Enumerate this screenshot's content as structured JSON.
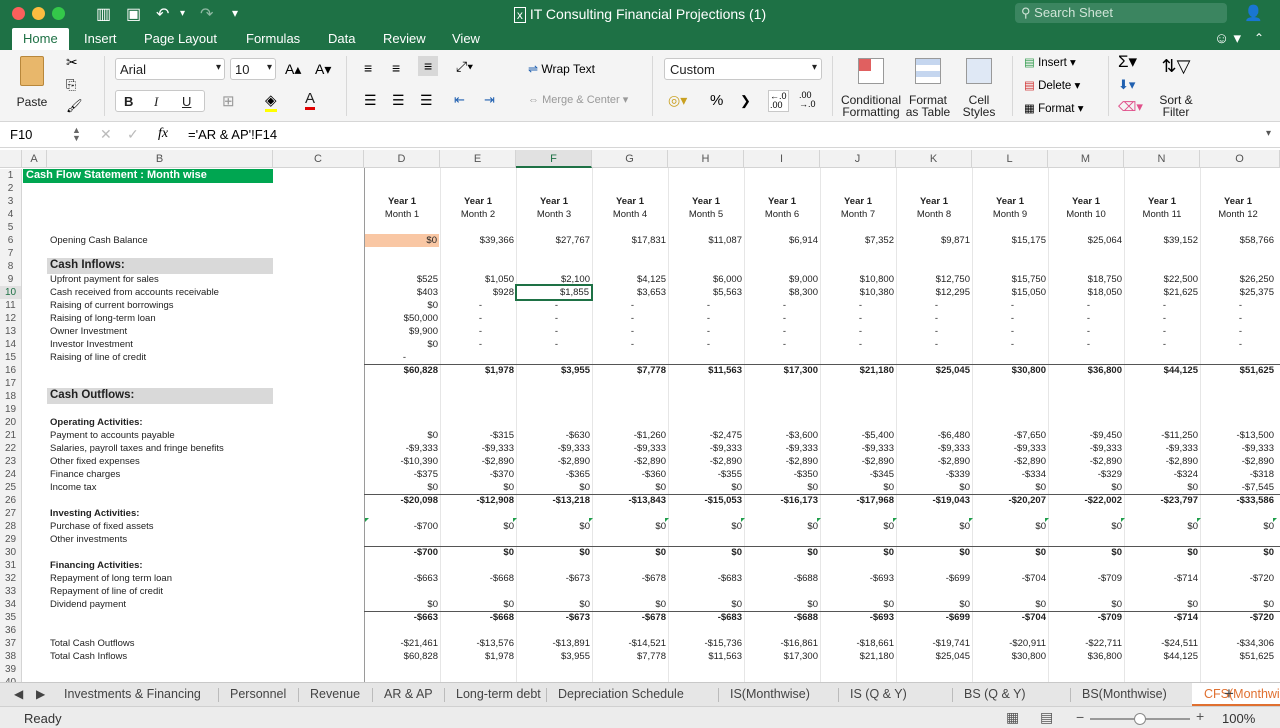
{
  "app": {
    "title": "IT Consulting Financial Projections (1)",
    "search_placeholder": "Search Sheet",
    "colors": {
      "accent": "#1e7145",
      "active_sheet": "#e07030",
      "title_fill": "#00a651",
      "opening_highlight": "#f9c7a4"
    }
  },
  "ribbon_tabs": [
    "Home",
    "Insert",
    "Page Layout",
    "Formulas",
    "Data",
    "Review",
    "View"
  ],
  "ribbon": {
    "paste": "Paste",
    "font_name": "Arial",
    "font_size": "10",
    "bold": "B",
    "italic": "I",
    "underline": "U",
    "wrap_text": "Wrap Text",
    "merge_center": "Merge & Center",
    "number_format": "Custom",
    "percent": "%",
    "comma": "❯",
    "cond_format": [
      "Conditional",
      "Formatting"
    ],
    "format_table": [
      "Format",
      "as Table"
    ],
    "cell_styles": [
      "Cell",
      "Styles"
    ],
    "insert": "Insert",
    "delete": "Delete",
    "format": "Format",
    "sort_filter": [
      "Sort &",
      "Filter"
    ]
  },
  "formula_bar": {
    "name_box": "F10",
    "formula": "='AR & AP'!F14"
  },
  "columns": [
    "A",
    "B",
    "C",
    "D",
    "E",
    "F",
    "G",
    "H",
    "I",
    "J",
    "K",
    "L",
    "M",
    "N",
    "O"
  ],
  "selected_col": "F",
  "selected_row": "10",
  "sheet": {
    "title": "Cash Flow Statement : Month wise",
    "year_labels": [
      "Year 1",
      "Year 1",
      "Year 1",
      "Year 1",
      "Year 1",
      "Year 1",
      "Year 1",
      "Year 1",
      "Year 1",
      "Year 1",
      "Year 1",
      "Year 1"
    ],
    "month_labels": [
      "Month 1",
      "Month 2",
      "Month 3",
      "Month 4",
      "Month 5",
      "Month 6",
      "Month 7",
      "Month 8",
      "Month 9",
      "Month 10",
      "Month 11",
      "Month 12"
    ],
    "rows": [
      {
        "r": 6,
        "label": "Opening Cash Balance",
        "values": [
          "$0",
          "$39,366",
          "$27,767",
          "$17,831",
          "$11,087",
          "$6,914",
          "$7,352",
          "$9,871",
          "$15,175",
          "$25,064",
          "$39,152",
          "$58,766"
        ]
      },
      {
        "r": 8,
        "label": "Cash Inflows:",
        "section": true
      },
      {
        "r": 9,
        "label": "Upfront payment for sales",
        "values": [
          "$525",
          "$1,050",
          "$2,100",
          "$4,125",
          "$6,000",
          "$9,000",
          "$10,800",
          "$12,750",
          "$15,750",
          "$18,750",
          "$22,500",
          "$26,250"
        ]
      },
      {
        "r": 10,
        "label": "Cash received from accounts receivable",
        "values": [
          "$403",
          "$928",
          "$1,855",
          "$3,653",
          "$5,563",
          "$8,300",
          "$10,380",
          "$12,295",
          "$15,050",
          "$18,050",
          "$21,625",
          "$25,375"
        ]
      },
      {
        "r": 11,
        "label": "Raising of current borrowings",
        "values": [
          "$0",
          "-",
          "-",
          "-",
          "-",
          "-",
          "-",
          "-",
          "-",
          "-",
          "-",
          "-"
        ]
      },
      {
        "r": 12,
        "label": "Raising of long-term loan",
        "values": [
          "$50,000",
          "-",
          "-",
          "-",
          "-",
          "-",
          "-",
          "-",
          "-",
          "-",
          "-",
          "-"
        ]
      },
      {
        "r": 13,
        "label": "Owner Investment",
        "values": [
          "$9,900",
          "-",
          "-",
          "-",
          "-",
          "-",
          "-",
          "-",
          "-",
          "-",
          "-",
          "-"
        ]
      },
      {
        "r": 14,
        "label": "Investor Investment",
        "values": [
          "$0",
          "-",
          "-",
          "-",
          "-",
          "-",
          "-",
          "-",
          "-",
          "-",
          "-",
          "-"
        ]
      },
      {
        "r": 15,
        "label": "Raising of line of credit",
        "values": [
          "-",
          "",
          "",
          "",
          "",
          "",
          "",
          "",
          "",
          "",
          "",
          ""
        ]
      },
      {
        "r": 16,
        "label": "",
        "bold": true,
        "values": [
          "$60,828",
          "$1,978",
          "$3,955",
          "$7,778",
          "$11,563",
          "$17,300",
          "$21,180",
          "$25,045",
          "$30,800",
          "$36,800",
          "$44,125",
          "$51,625"
        ]
      },
      {
        "r": 18,
        "label": "Cash Outflows:",
        "section": true
      },
      {
        "r": 20,
        "label": "Operating Activities:",
        "bold": true
      },
      {
        "r": 21,
        "label": "Payment to accounts payable",
        "values": [
          "$0",
          "-$315",
          "-$630",
          "-$1,260",
          "-$2,475",
          "-$3,600",
          "-$5,400",
          "-$6,480",
          "-$7,650",
          "-$9,450",
          "-$11,250",
          "-$13,500"
        ]
      },
      {
        "r": 22,
        "label": "Salaries, payroll taxes and fringe benefits",
        "values": [
          "-$9,333",
          "-$9,333",
          "-$9,333",
          "-$9,333",
          "-$9,333",
          "-$9,333",
          "-$9,333",
          "-$9,333",
          "-$9,333",
          "-$9,333",
          "-$9,333",
          "-$9,333"
        ]
      },
      {
        "r": 23,
        "label": "Other fixed expenses",
        "values": [
          "-$10,390",
          "-$2,890",
          "-$2,890",
          "-$2,890",
          "-$2,890",
          "-$2,890",
          "-$2,890",
          "-$2,890",
          "-$2,890",
          "-$2,890",
          "-$2,890",
          "-$2,890"
        ]
      },
      {
        "r": 24,
        "label": "Finance charges",
        "values": [
          "-$375",
          "-$370",
          "-$365",
          "-$360",
          "-$355",
          "-$350",
          "-$345",
          "-$339",
          "-$334",
          "-$329",
          "-$324",
          "-$318"
        ]
      },
      {
        "r": 25,
        "label": "Income tax",
        "values": [
          "$0",
          "$0",
          "$0",
          "$0",
          "$0",
          "$0",
          "$0",
          "$0",
          "$0",
          "$0",
          "$0",
          "-$7,545"
        ]
      },
      {
        "r": 26,
        "label": "",
        "bold": true,
        "values": [
          "-$20,098",
          "-$12,908",
          "-$13,218",
          "-$13,843",
          "-$15,053",
          "-$16,173",
          "-$17,968",
          "-$19,043",
          "-$20,207",
          "-$22,002",
          "-$23,797",
          "-$33,586"
        ]
      },
      {
        "r": 27,
        "label": "Investing Activities:",
        "bold": true
      },
      {
        "r": 28,
        "label": "Purchase of fixed assets",
        "values": [
          "-$700",
          "$0",
          "$0",
          "$0",
          "$0",
          "$0",
          "$0",
          "$0",
          "$0",
          "$0",
          "$0",
          "$0"
        ]
      },
      {
        "r": 29,
        "label": "Other investments"
      },
      {
        "r": 30,
        "label": "",
        "bold": true,
        "values": [
          "-$700",
          "$0",
          "$0",
          "$0",
          "$0",
          "$0",
          "$0",
          "$0",
          "$0",
          "$0",
          "$0",
          "$0"
        ]
      },
      {
        "r": 31,
        "label": "Financing Activities:",
        "bold": true
      },
      {
        "r": 32,
        "label": "Repayment of long term loan",
        "values": [
          "-$663",
          "-$668",
          "-$673",
          "-$678",
          "-$683",
          "-$688",
          "-$693",
          "-$699",
          "-$704",
          "-$709",
          "-$714",
          "-$720"
        ]
      },
      {
        "r": 33,
        "label": "Repayment of line of credit"
      },
      {
        "r": 34,
        "label": "Dividend payment",
        "values": [
          "$0",
          "$0",
          "$0",
          "$0",
          "$0",
          "$0",
          "$0",
          "$0",
          "$0",
          "$0",
          "$0",
          "$0"
        ]
      },
      {
        "r": 35,
        "label": "",
        "bold": true,
        "values": [
          "-$663",
          "-$668",
          "-$673",
          "-$678",
          "-$683",
          "-$688",
          "-$693",
          "-$699",
          "-$704",
          "-$709",
          "-$714",
          "-$720"
        ]
      },
      {
        "r": 37,
        "label": "Total Cash Outflows",
        "values": [
          "-$21,461",
          "-$13,576",
          "-$13,891",
          "-$14,521",
          "-$15,736",
          "-$16,861",
          "-$18,661",
          "-$19,741",
          "-$20,911",
          "-$22,711",
          "-$24,511",
          "-$34,306"
        ]
      },
      {
        "r": 38,
        "label": "Total Cash Inflows",
        "values": [
          "$60,828",
          "$1,978",
          "$3,955",
          "$7,778",
          "$11,563",
          "$17,300",
          "$21,180",
          "$25,045",
          "$30,800",
          "$36,800",
          "$44,125",
          "$51,625"
        ]
      }
    ]
  },
  "sheet_tabs": [
    "Investments & Financing",
    "Personnel",
    "Revenue",
    "AR & AP",
    "Long-term debt",
    "Depreciation Schedule",
    "IS(Monthwise)",
    "IS (Q & Y)",
    "BS (Q & Y)",
    "BS(Monthwise)",
    "CFS(Monthwise)"
  ],
  "active_sheet": "CFS(Monthwise)",
  "status": {
    "mode": "Ready",
    "zoom": "100%"
  }
}
